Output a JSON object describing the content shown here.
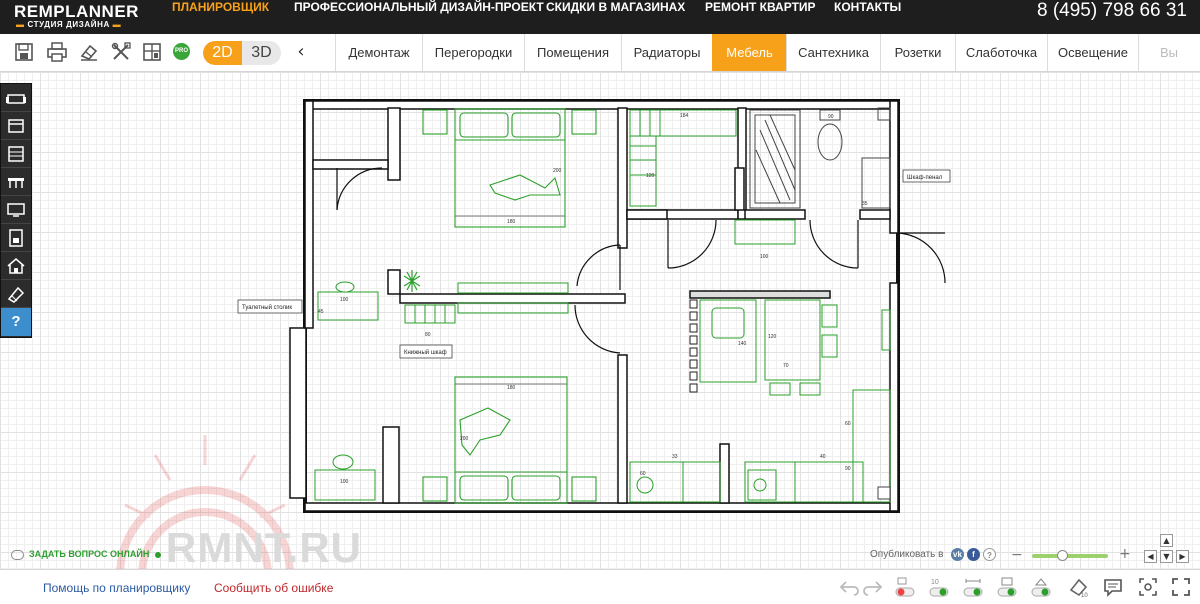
{
  "nav": {
    "logo_top": "REMPLANNER",
    "logo_bottom": "СТУДИЯ ДИЗАЙНА",
    "links": [
      "ПЛАНИРОВЩИК",
      "ПРОФЕССИОНАЛЬНЫЙ ДИЗАЙН-ПРОЕКТ",
      "СКИДКИ В МАГАЗИНАХ",
      "РЕМОНТ КВАРТИР",
      "КОНТАКТЫ"
    ],
    "phone": "8 (495) 798 66 31"
  },
  "toolbar": {
    "pro_badge": "PRO",
    "view_2d": "2D",
    "view_3d": "3D",
    "prev_arrow": "‹",
    "categories": [
      "Демонтаж",
      "Перегородки",
      "Помещения",
      "Радиаторы",
      "Мебель",
      "Сантехника",
      "Розетки",
      "Слаботочка",
      "Освещение",
      "Вы"
    ],
    "active_category": "Мебель"
  },
  "sidebar": {
    "help_label": "?"
  },
  "plan": {
    "labels": {
      "vanity": "Туалетный столик",
      "bookcase": "Книжный шкаф",
      "cabinet": "Шкаф-пенал"
    },
    "dims": {
      "bed_top": "180",
      "bed_top_side": "200",
      "bed_bottom": "180",
      "bed_bottom_side": "200",
      "desk_top": "100",
      "desk_top_side": "45",
      "bookcase_w": "80",
      "wardrobe_top": "184",
      "wardrobe_side": "120",
      "hall_shelf": "100",
      "hall_shelf_side": "45",
      "sofa": "140",
      "table_w": "120",
      "table_d": "70",
      "bath_side": "90",
      "cabinet_side": "35",
      "kitchen_a": "60",
      "kitchen_b": "33",
      "kitchen_c": "40",
      "kitchen_d": "90",
      "kitchen_e": "60",
      "desk_bottom": "100"
    }
  },
  "bottom": {
    "ask_online": "ЗАДАТЬ ВОПРОС ОНЛАЙН",
    "publish_label": "Опубликовать в",
    "social": [
      "vk",
      "f",
      "?"
    ],
    "zoom_minus": "−",
    "zoom_plus": "+",
    "zoom_level": 0.4,
    "help_link": "Помощь по планировщику",
    "report_link": "Сообщить об ошибке"
  },
  "watermark": "RMNT.RU",
  "colors": {
    "accent": "#f7a11a",
    "topbar": "#1e1e1e",
    "furniture": "#2aa02a",
    "link_blue": "#2c5aa0",
    "link_red": "#c0282d"
  },
  "icons": [
    "save-icon",
    "print-icon",
    "eraser-icon",
    "tools-icon",
    "layout-icon",
    "undo-icon",
    "redo-icon",
    "toggle-icon",
    "comment-icon",
    "focus-icon",
    "fullscreen-icon"
  ]
}
